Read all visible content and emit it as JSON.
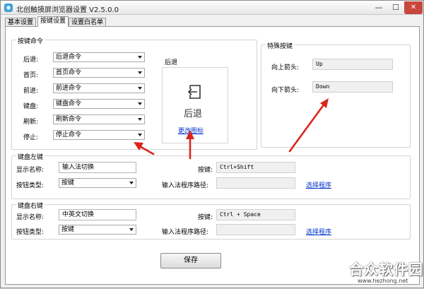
{
  "window": {
    "title": "北创触摸屏浏览器设置 V2.5.0.0",
    "minimize": "—",
    "maximize": "☐",
    "close": "✕"
  },
  "tabs": [
    {
      "label": "基本设置"
    },
    {
      "label": "按键设置"
    },
    {
      "label": "设置白名单"
    }
  ],
  "key_commands": {
    "title": "按键命令",
    "rows": [
      {
        "label": "后退:",
        "value": "后退命令"
      },
      {
        "label": "首页:",
        "value": "首页命令"
      },
      {
        "label": "前进:",
        "value": "前进命令"
      },
      {
        "label": "键盘:",
        "value": "键盘命令"
      },
      {
        "label": "刷新:",
        "value": "刷新命令"
      },
      {
        "label": "停止:",
        "value": "停止命令"
      }
    ]
  },
  "preview": {
    "title": "后退",
    "icon_label": "后退",
    "change_icon": "更改图标"
  },
  "special_keys": {
    "title": "特殊按键",
    "up_label": "向上箭头:",
    "up_value": "Up",
    "down_label": "向下箭头:",
    "down_value": "Down"
  },
  "left_key": {
    "title": "键盘左键",
    "display_name_label": "显示名称:",
    "display_name_value": "输入法切换",
    "button_type_label": "按钮类型:",
    "button_type_value": "按键",
    "hotkey_label": "按键:",
    "hotkey_value": "Ctrl+Shift",
    "path_label": "输入法程序路径:",
    "path_value": "",
    "select_program": "选择程序"
  },
  "right_key": {
    "title": "键盘右键",
    "display_name_label": "显示名称:",
    "display_name_value": "中英文切换",
    "button_type_label": "按钮类型:",
    "button_type_value": "按键",
    "hotkey_label": "按键:",
    "hotkey_value": "Ctrl + Space",
    "path_label": "输入法程序路径:",
    "path_value": "",
    "select_program": "选择程序"
  },
  "save_button": "保存",
  "watermark": {
    "brand": "合众软件园",
    "url": "www.hezhong.net"
  },
  "colors": {
    "arrow": "#d9261c",
    "link": "#0033cc",
    "close": "#c9463d"
  }
}
